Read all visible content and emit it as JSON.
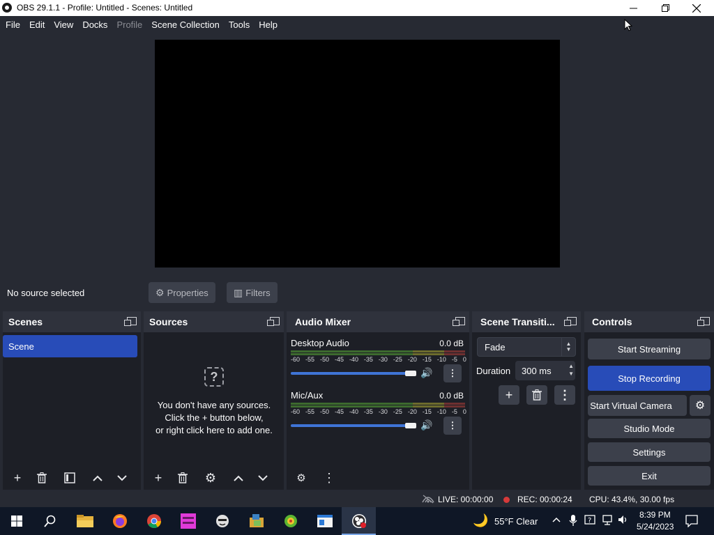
{
  "window": {
    "title": "OBS 29.1.1 - Profile: Untitled - Scenes: Untitled",
    "minimize_icon": "minimize-icon",
    "maximize_icon": "maximize-icon",
    "close_icon": "close-icon"
  },
  "menu": [
    "File",
    "Edit",
    "View",
    "Docks",
    "Profile",
    "Scene Collection",
    "Tools",
    "Help"
  ],
  "source_bar": {
    "status": "No source selected",
    "properties_label": "Properties",
    "filters_label": "Filters"
  },
  "scenes": {
    "title": "Scenes",
    "items": [
      "Scene"
    ]
  },
  "sources": {
    "title": "Sources",
    "empty_line1": "You don't have any sources.",
    "empty_line2": "Click the + button below,",
    "empty_line3": "or right click here to add one."
  },
  "audio_mixer": {
    "title": "Audio Mixer",
    "ticks": [
      "-60",
      "-55",
      "-50",
      "-45",
      "-40",
      "-35",
      "-30",
      "-25",
      "-20",
      "-15",
      "-10",
      "-5",
      "0"
    ],
    "channels": [
      {
        "name": "Desktop Audio",
        "db": "0.0 dB",
        "volume": 1.0
      },
      {
        "name": "Mic/Aux",
        "db": "0.0 dB",
        "volume": 1.0
      }
    ]
  },
  "transitions": {
    "title": "Scene Transiti...",
    "selected": "Fade",
    "duration_label": "Duration",
    "duration_value": "300 ms"
  },
  "controls": {
    "title": "Controls",
    "start_streaming": "Start Streaming",
    "stop_recording": "Stop Recording",
    "virtual_camera": "Start Virtual Camera",
    "studio_mode": "Studio Mode",
    "settings": "Settings",
    "exit": "Exit"
  },
  "status": {
    "live": "LIVE: 00:00:00",
    "rec": "REC: 00:00:24",
    "cpu": "CPU: 43.4%, 30.00 fps"
  },
  "taskbar": {
    "weather": "55°F  Clear",
    "time": "8:39 PM",
    "date": "5/24/2023"
  },
  "colors": {
    "accent": "#284cb8",
    "dock_bg": "#1d1f26",
    "header_bg": "#2f323c",
    "rec": "#d63a3a"
  }
}
